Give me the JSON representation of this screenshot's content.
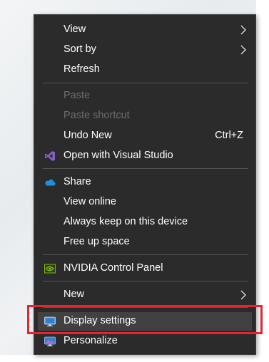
{
  "menu": {
    "items": [
      {
        "label": "View",
        "submenu": true
      },
      {
        "label": "Sort by",
        "submenu": true
      },
      {
        "label": "Refresh"
      },
      {
        "label": "Paste",
        "disabled": true
      },
      {
        "label": "Paste shortcut",
        "disabled": true
      },
      {
        "label": "Undo New",
        "shortcut": "Ctrl+Z"
      },
      {
        "label": "Open with Visual Studio",
        "icon": "visual-studio-icon"
      },
      {
        "label": "Share",
        "icon": "onedrive-cloud-icon"
      },
      {
        "label": "View online"
      },
      {
        "label": "Always keep on this device"
      },
      {
        "label": "Free up space"
      },
      {
        "label": "NVIDIA Control Panel",
        "icon": "nvidia-icon"
      },
      {
        "label": "New",
        "submenu": true
      },
      {
        "label": "Display settings",
        "icon": "display-icon",
        "highlighted": true
      },
      {
        "label": "Personalize",
        "icon": "personalize-icon"
      }
    ]
  },
  "colors": {
    "menu_background": "#2b2b2b",
    "highlight": "#414141",
    "annotation_box": "#e8242e",
    "disabled_text": "#6d6d6d"
  }
}
